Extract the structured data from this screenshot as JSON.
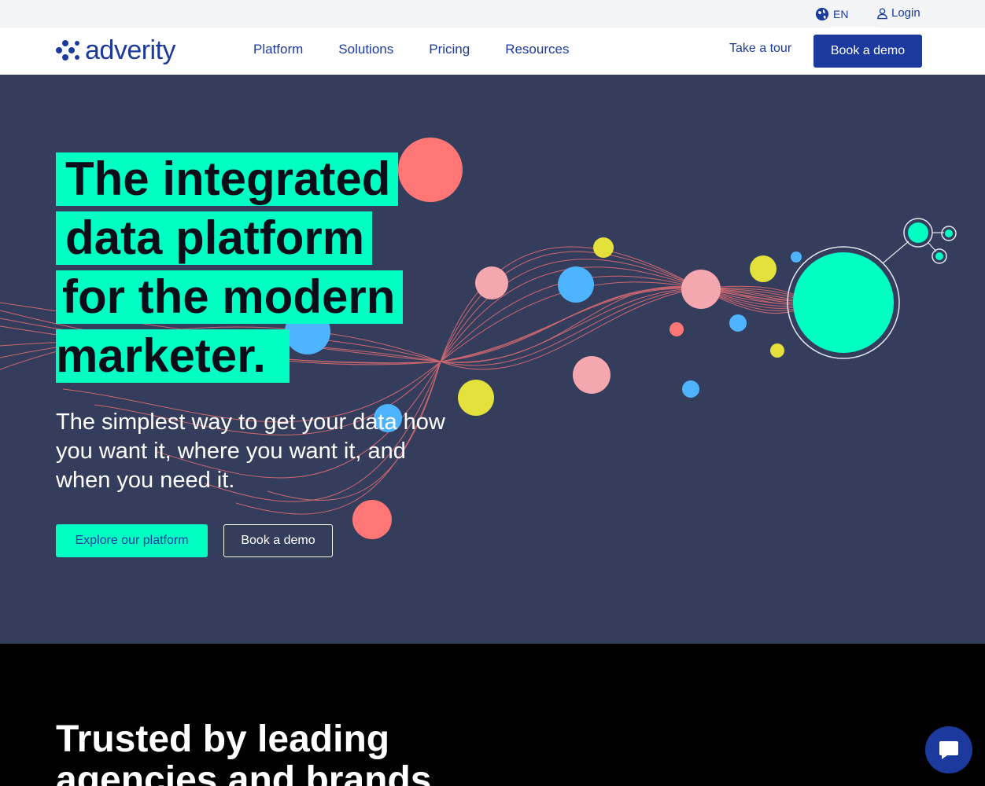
{
  "utility": {
    "language": "EN",
    "login": "Login"
  },
  "header": {
    "logo_text": "adverity",
    "nav": [
      "Platform",
      "Solutions",
      "Pricing",
      "Resources"
    ],
    "tour": "Take a tour",
    "demo": "Book a demo"
  },
  "hero": {
    "headline": [
      "The integrated",
      "data platform",
      "for the modern",
      "marketer."
    ],
    "subtitle": "The simplest way to get your data how you want it, where you want it, and when you need it.",
    "explore_button": "Explore our platform",
    "book_button": "Book a demo"
  },
  "trusted": {
    "title": "Trusted by leading agencies and brands"
  },
  "colors": {
    "brand_blue": "#1c3a9e",
    "accent_green": "#00ffc3",
    "hero_bg": "#353d5c",
    "coral": "#ff7676",
    "pink": "#f4a7ae",
    "sky": "#4fb4ff",
    "yellow": "#e4e03c"
  },
  "icons": {
    "language": "globe-icon",
    "login": "user-icon",
    "logo": "adverity-logo-icon",
    "chat": "chat-bubble-icon"
  }
}
